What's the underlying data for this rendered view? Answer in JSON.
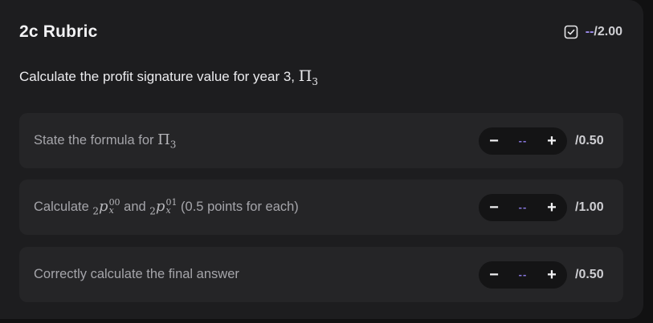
{
  "header": {
    "title": "2c Rubric",
    "score": "--",
    "max": "/2.00",
    "icon": "check-square-icon"
  },
  "question": {
    "text": "Calculate the profit signature value for year 3,",
    "symbol": "Π",
    "subscript": "3"
  },
  "items": [
    {
      "label": "State the formula for",
      "symbol": "Π",
      "subscript": "3",
      "value": "--",
      "max": "/0.50"
    },
    {
      "label_prefix": "Calculate",
      "label_and": "and",
      "label_suffix": "(0.5 points for each)",
      "sym1_pre": "2",
      "sym1": "p",
      "sym1_sup": "00",
      "sym1_sub": "x",
      "sym2_pre": "2",
      "sym2": "p",
      "sym2_sup": "01",
      "sym2_sub": "x",
      "value": "--",
      "max": "/1.00"
    },
    {
      "label": "Correctly calculate the final answer",
      "value": "--",
      "max": "/0.50"
    }
  ],
  "controls": {
    "minus": "−",
    "plus": "+"
  },
  "colors": {
    "accent": "#9e8df0",
    "panel": "#1d1d1f",
    "item_bg": "#252527"
  }
}
